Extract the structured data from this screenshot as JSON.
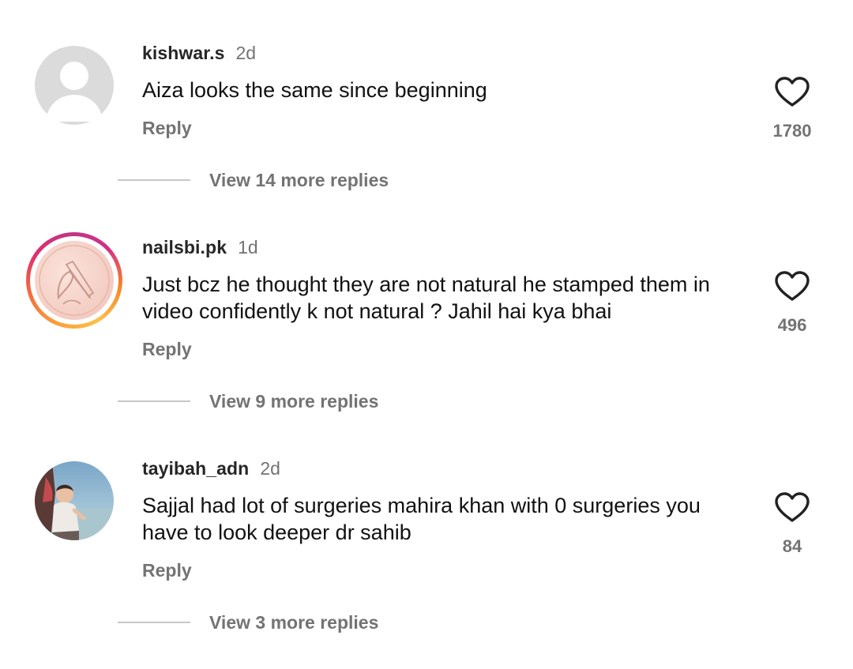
{
  "comments": [
    {
      "username": "kishwar.s",
      "time": "2d",
      "text": "Aiza looks the same since beginning",
      "reply_label": "Reply",
      "likes": "1780",
      "view_replies": "View 14 more replies",
      "avatar_icon": "default-avatar-icon"
    },
    {
      "username": "nailsbi.pk",
      "time": "1d",
      "text": "Just bcz he thought they are not natural he stamped them in video confidently k not natural ? Jahil hai kya bhai",
      "reply_label": "Reply",
      "likes": "496",
      "view_replies": "View 9 more replies",
      "avatar_icon": "nail-logo-avatar"
    },
    {
      "username": "tayibah_adn",
      "time": "2d",
      "text": "Sajjal had lot of surgeries mahira khan with 0 surgeries you have to look deeper dr sahib",
      "reply_label": "Reply",
      "likes": "84",
      "view_replies": "View 3 more replies",
      "avatar_icon": "photo-avatar"
    }
  ],
  "colors": {
    "text_primary": "#111111",
    "text_secondary": "#737373",
    "divider": "#c7c7c7",
    "story_ring": [
      "#f9a13c",
      "#e1306c",
      "#c13584"
    ]
  },
  "icons": {
    "like": "heart-outline-icon"
  }
}
